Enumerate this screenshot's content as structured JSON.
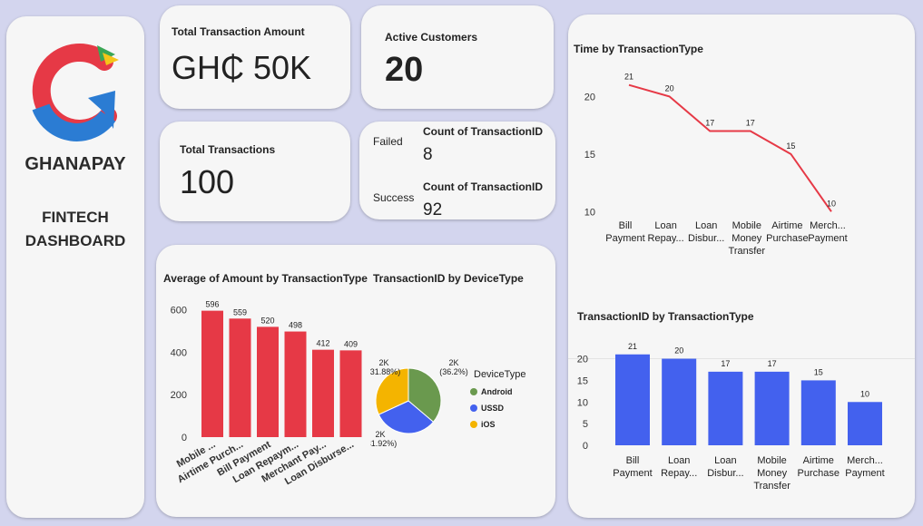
{
  "brand": {
    "name": "GHANAPAY",
    "subtitle_line1": "FINTECH",
    "subtitle_line2": "DASHBOARD",
    "colors": {
      "red": "#e63946",
      "blue": "#2b7cd3",
      "green": "#3aa655",
      "yellow": "#f5c518"
    }
  },
  "kpis": {
    "total_amount": {
      "label": "Total Transaction Amount",
      "value": "GH₵ 50K"
    },
    "active_customers": {
      "label": "Active Customers",
      "value": "20"
    },
    "total_transactions": {
      "label": "Total Transactions",
      "value": "100"
    },
    "status": {
      "rows": [
        {
          "status": "Failed",
          "header": "Count of TransactionID",
          "value": "8"
        },
        {
          "status": "Success",
          "header": "Count of TransactionID",
          "value": "92"
        }
      ]
    }
  },
  "chart_data": [
    {
      "id": "avg_amount",
      "type": "bar",
      "title": "Average of Amount by TransactionType",
      "categories": [
        "Mobile ...",
        "Airtime Purch...",
        "Bill Payment",
        "Loan Repaym...",
        "Merchant Pay...",
        "Loan Disburse..."
      ],
      "values": [
        596,
        559,
        520,
        498,
        412,
        409
      ],
      "yticks": [
        0,
        200,
        400,
        600
      ],
      "ylim": [
        0,
        650
      ],
      "color": "#e63946"
    },
    {
      "id": "device",
      "type": "pie",
      "title": "TransactionID by DeviceType",
      "legend_title": "DeviceType",
      "slices": [
        {
          "name": "Android",
          "value": 36.2,
          "label_top": "2K",
          "label_pct": "(36.2%)",
          "color": "#6a994e"
        },
        {
          "name": "USSD",
          "value": 31.92,
          "label_top": "2K",
          "label_pct": "(31.92%)",
          "color": "#4361ee"
        },
        {
          "name": "iOS",
          "value": 31.88,
          "label_top": "2K",
          "label_pct": "(31.88%)",
          "color": "#f4b400"
        }
      ]
    },
    {
      "id": "time_line",
      "type": "line",
      "title": "Time by TransactionType",
      "categories": [
        "Bill Payment",
        "Loan Repay...",
        "Loan Disbur...",
        "Mobile Money Transfer",
        "Airtime Purchase",
        "Merch... Payment"
      ],
      "values": [
        21,
        20,
        17,
        17,
        15,
        10
      ],
      "yticks": [
        10,
        15,
        20
      ],
      "ylim": [
        9,
        22
      ],
      "color": "#e63946"
    },
    {
      "id": "count_bar",
      "type": "bar",
      "title": "TransactionID by TransactionType",
      "categories": [
        "Bill Payment",
        "Loan Repay...",
        "Loan Disbur...",
        "Mobile Money Transfer",
        "Airtime Purchase",
        "Merch... Payment"
      ],
      "values": [
        21,
        20,
        17,
        17,
        15,
        10
      ],
      "yticks": [
        0,
        5,
        10,
        15,
        20
      ],
      "ylim": [
        0,
        22
      ],
      "color": "#4361ee"
    }
  ]
}
